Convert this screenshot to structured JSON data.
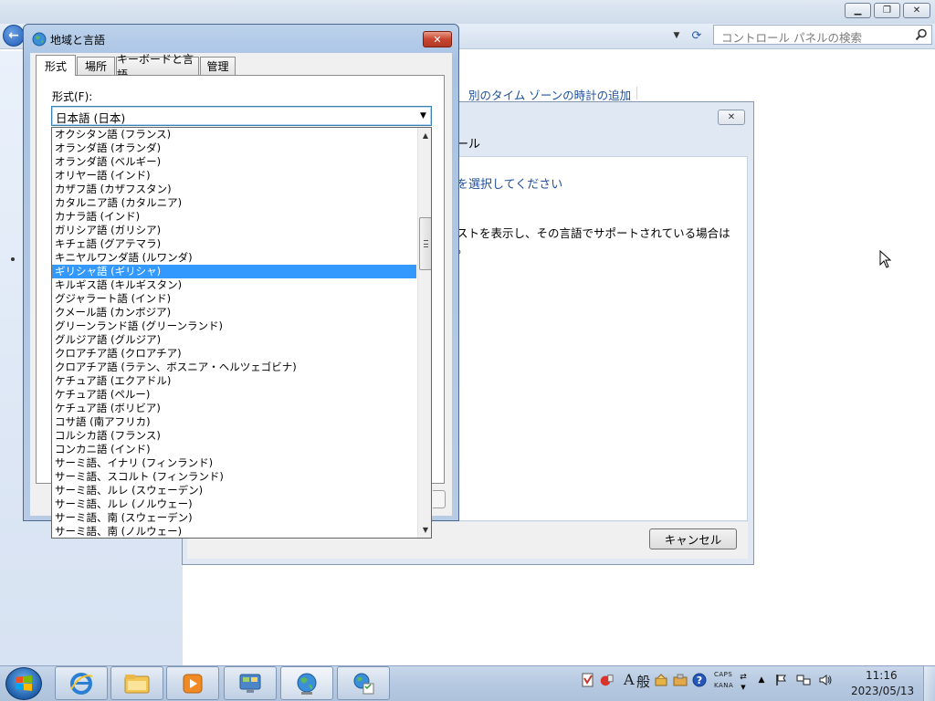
{
  "control_panel": {
    "search_placeholder": "コントロール パネルの検索",
    "timezone_link": "別のタイム ゾーンの時計の追加"
  },
  "display_language_dialog": {
    "heading": "ール",
    "subheading": "を選択してください",
    "description_line1": "ストを表示し、その言語でサポートされている場合は",
    "description_line2": "。",
    "cancel_label": "キャンセル"
  },
  "region_dialog": {
    "title": "地域と言語",
    "tabs": [
      {
        "label": "形式"
      },
      {
        "label": "場所"
      },
      {
        "label": "キーボードと言語"
      },
      {
        "label": "管理"
      }
    ],
    "format_label": "形式(F):",
    "format_selected": "日本語 (日本)"
  },
  "dropdown": {
    "items": [
      {
        "label": "オクシタン語 (フランス)"
      },
      {
        "label": "オランダ語 (オランダ)"
      },
      {
        "label": "オランダ語 (ベルギー)"
      },
      {
        "label": "オリヤー語 (インド)"
      },
      {
        "label": "カザフ語 (カザフスタン)"
      },
      {
        "label": "カタルニア語 (カタルニア)"
      },
      {
        "label": "カナラ語 (インド)"
      },
      {
        "label": "ガリシア語 (ガリシア)"
      },
      {
        "label": "キチェ語 (グアテマラ)"
      },
      {
        "label": "キニヤルワンダ語 (ルワンダ)"
      },
      {
        "label": "ギリシャ語 (ギリシャ)"
      },
      {
        "label": "キルギス語 (キルギスタン)"
      },
      {
        "label": "グジャラート語 (インド)"
      },
      {
        "label": "クメール語 (カンボジア)"
      },
      {
        "label": "グリーンランド語 (グリーンランド)"
      },
      {
        "label": "グルジア語 (グルジア)"
      },
      {
        "label": "クロアチア語 (クロアチア)"
      },
      {
        "label": "クロアチア語 (ラテン、ボスニア・ヘルツェゴビナ)"
      },
      {
        "label": "ケチュア語 (エクアドル)"
      },
      {
        "label": "ケチュア語 (ペルー)"
      },
      {
        "label": "ケチュア語 (ボリビア)"
      },
      {
        "label": "コサ語 (南アフリカ)"
      },
      {
        "label": "コルシカ語 (フランス)"
      },
      {
        "label": "コンカニ語 (インド)"
      },
      {
        "label": "サーミ語、イナリ (フィンランド)"
      },
      {
        "label": "サーミ語、スコルト (フィンランド)"
      },
      {
        "label": "サーミ語、ルレ (スウェーデン)"
      },
      {
        "label": "サーミ語、ルレ (ノルウェー)"
      },
      {
        "label": "サーミ語、南 (スウェーデン)"
      },
      {
        "label": "サーミ語、南 (ノルウェー)"
      }
    ],
    "selected_index": 10
  },
  "taskbar": {
    "ime_char": "A",
    "ime_mode": "般",
    "caps": "CAPS",
    "kana": "KANA",
    "time": "11:16",
    "date": "2023/05/13"
  },
  "colors": {
    "selection": "#3399ff",
    "link": "#1e4f9c"
  }
}
